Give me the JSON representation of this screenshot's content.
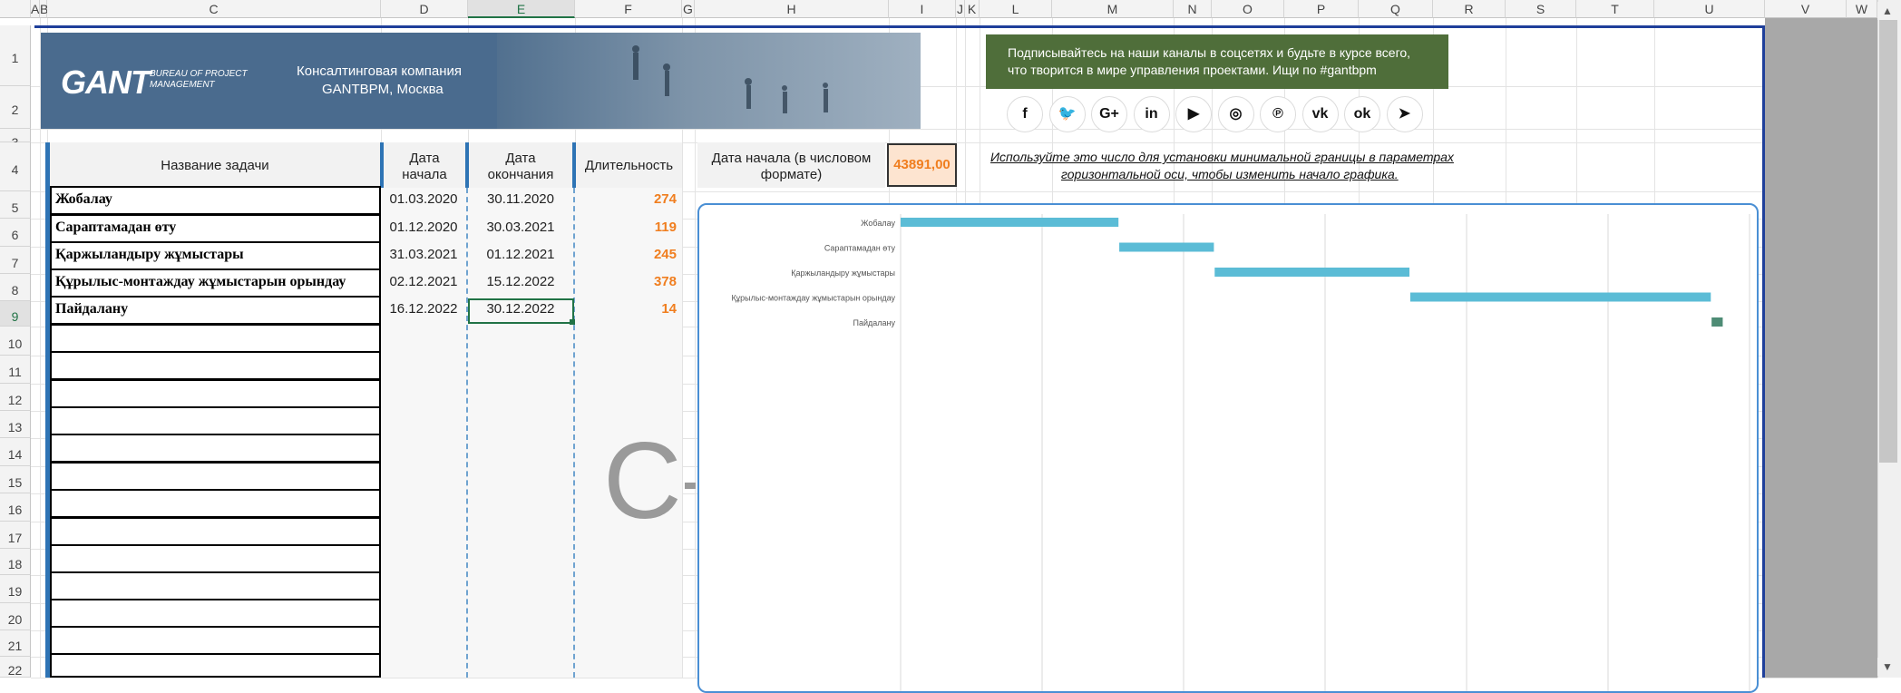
{
  "sheet": {
    "columns": [
      "A",
      "B",
      "C",
      "D",
      "E",
      "F",
      "G",
      "H",
      "I",
      "J",
      "K",
      "L",
      "M",
      "N",
      "O",
      "P",
      "Q",
      "R",
      "S",
      "T",
      "U",
      "V",
      "W"
    ],
    "selected_column": "E",
    "rows": [
      "1",
      "2",
      "3",
      "4",
      "5",
      "6",
      "7",
      "8",
      "9",
      "10",
      "11",
      "12",
      "13",
      "14",
      "15",
      "16",
      "17",
      "18",
      "19",
      "20",
      "21",
      "22"
    ],
    "selected_row": "9"
  },
  "banner": {
    "logo_main": "GANT",
    "logo_sub1": "BUREAU OF PROJECT",
    "logo_sub2": "MANAGEMENT",
    "company_line1": "Консалтинговая компания",
    "company_line2": "GANTBPM, Москва",
    "bg_color": "#4a6b8e"
  },
  "promo": {
    "line1": "Подписывайтесь на наши каналы в соцсетях и будьте в курсе всего,",
    "line2": "что творится в мире управления проектами. Ищи по #gantbpm",
    "bg_color": "#4f6e3a"
  },
  "social_icons": [
    {
      "name": "facebook-icon",
      "glyph": "f"
    },
    {
      "name": "twitter-icon",
      "glyph": "🐦"
    },
    {
      "name": "google-plus-icon",
      "glyph": "G+"
    },
    {
      "name": "linkedin-icon",
      "glyph": "in"
    },
    {
      "name": "youtube-icon",
      "glyph": "▶"
    },
    {
      "name": "instagram-icon",
      "glyph": "◎"
    },
    {
      "name": "pinterest-icon",
      "glyph": "℗"
    },
    {
      "name": "vk-icon",
      "glyph": "vk"
    },
    {
      "name": "odnoklassniki-icon",
      "glyph": "ok"
    },
    {
      "name": "telegram-icon",
      "glyph": "➤"
    }
  ],
  "table": {
    "header_task": "Название задачи",
    "header_start_l1": "Дата",
    "header_start_l2": "начала",
    "header_end_l1": "Дата",
    "header_end_l2": "окончания",
    "header_duration": "Длительность",
    "rows": [
      {
        "task": "Жобалау",
        "start": "01.03.2020",
        "end": "30.11.2020",
        "duration": "274"
      },
      {
        "task": "Сараптамадан өту",
        "start": "01.12.2020",
        "end": "30.03.2021",
        "duration": "119"
      },
      {
        "task": "Қаржыландыру жұмыстары",
        "start": "31.03.2021",
        "end": "01.12.2021",
        "duration": "245"
      },
      {
        "task": "Құрылыс-монтаждау жұмыстарын орындау",
        "start": "02.12.2021",
        "end": "15.12.2022",
        "duration": "378"
      },
      {
        "task": " Пайдалану",
        "start": "16.12.2022",
        "end": "30.12.2022",
        "duration": "14"
      }
    ]
  },
  "start_date_box": {
    "label_l1": "Дата начала (в числовом",
    "label_l2": "формате)",
    "value": "43891,00",
    "value_color": "#f07e1f"
  },
  "hint": {
    "line1": "Используйте это число для установки минимальной границы в параметрах",
    "line2": "горизонтальной оси, чтобы изменить начало графика."
  },
  "watermark": "C",
  "chart_data": {
    "type": "bar",
    "orientation": "horizontal-gantt",
    "categories": [
      "Жобалау",
      "Сараптамадан өту",
      "Қаржыландыру жұмыстары",
      "Құрылыс-монтаждау жұмыстарын орындау",
      "Пайдалану"
    ],
    "series": [
      {
        "values_start": [
          43891,
          44166,
          44286,
          44532,
          44911
        ],
        "values_duration": [
          274,
          119,
          245,
          378,
          14
        ]
      }
    ],
    "xlim": [
      43891,
      44961
    ],
    "grid": true,
    "bar_color": "#5bbcd6",
    "last_bar_color": "#4e8c75"
  }
}
